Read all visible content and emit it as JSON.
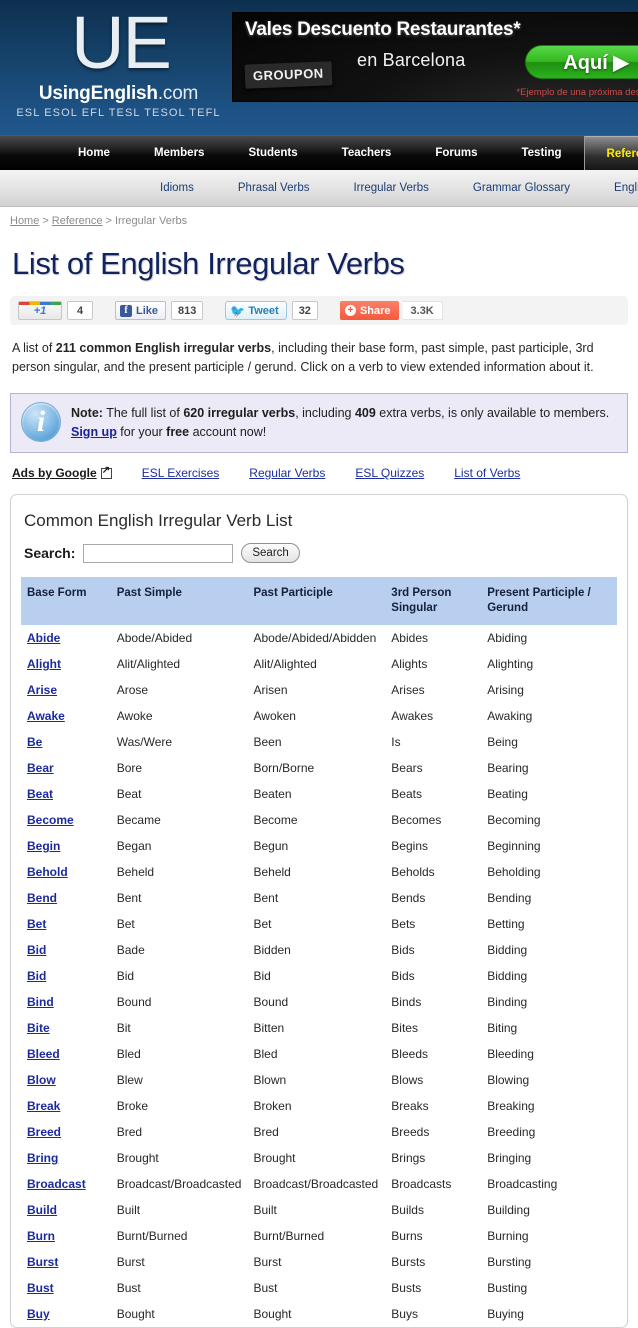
{
  "site": {
    "logo_mark": "UE",
    "logo_name": "UsingEnglish",
    "logo_tld": ".com",
    "logo_tagline": "ESL ESOL EFL TESL TESOL TEFL"
  },
  "ad": {
    "headline": "Vales Descuento Restaurantes*",
    "subline": "en Barcelona",
    "brand": "GROUPON",
    "cta": "Aquí ▶",
    "footnote": "*Ejemplo de una próxima descuento"
  },
  "mainnav": {
    "items": [
      {
        "label": "Home",
        "active": false
      },
      {
        "label": "Members",
        "active": false
      },
      {
        "label": "Students",
        "active": false
      },
      {
        "label": "Teachers",
        "active": false
      },
      {
        "label": "Forums",
        "active": false
      },
      {
        "label": "Testing",
        "active": false
      },
      {
        "label": "Reference",
        "active": true
      }
    ]
  },
  "subnav": {
    "items": [
      {
        "label": "Idioms"
      },
      {
        "label": "Phrasal Verbs"
      },
      {
        "label": "Irregular Verbs"
      },
      {
        "label": "Grammar Glossary"
      },
      {
        "label": "English"
      }
    ]
  },
  "breadcrumb": {
    "home": "Home",
    "section": "Reference",
    "current": "Irregular Verbs",
    "separator": ">"
  },
  "page": {
    "title": "List of English Irregular Verbs",
    "intro_part1": "A list of ",
    "intro_bold": "211 common English irregular verbs",
    "intro_part2": ", including their base form, past simple, past participle, 3rd person singular, and the present participle / gerund. Click on a verb to view extended information about it."
  },
  "social": {
    "gplus_label": "+1",
    "gplus_count": "4",
    "facebook_label": "Like",
    "facebook_icon": "f",
    "facebook_count": "813",
    "twitter_label": "Tweet",
    "twitter_count": "32",
    "share_label": "Share",
    "share_count": "3.3K"
  },
  "note": {
    "prefix": "Note:",
    "text1": " The full list of ",
    "bold1": "620 irregular verbs",
    "text2": ", including ",
    "bold2": "409",
    "text3": " extra verbs, is only available to members. ",
    "link": "Sign up",
    "text4": " for your ",
    "bold3": "free",
    "text5": " account now!"
  },
  "ads_by_google": {
    "label": "Ads by Google",
    "links": [
      "ESL Exercises",
      "Regular Verbs",
      "ESL Quizzes",
      "List of Verbs"
    ]
  },
  "verb_panel": {
    "title": "Common English Irregular Verb List",
    "search_label": "Search:",
    "search_value": "",
    "search_placeholder": "",
    "search_button": "Search",
    "columns": [
      "Base Form",
      "Past Simple",
      "Past Participle",
      "3rd Person Singular",
      "Present Participle / Gerund"
    ],
    "rows": [
      [
        "Abide",
        "Abode/Abided",
        "Abode/Abided/Abidden",
        "Abides",
        "Abiding"
      ],
      [
        "Alight",
        "Alit/Alighted",
        "Alit/Alighted",
        "Alights",
        "Alighting"
      ],
      [
        "Arise",
        "Arose",
        "Arisen",
        "Arises",
        "Arising"
      ],
      [
        "Awake",
        "Awoke",
        "Awoken",
        "Awakes",
        "Awaking"
      ],
      [
        "Be",
        "Was/Were",
        "Been",
        "Is",
        "Being"
      ],
      [
        "Bear",
        "Bore",
        "Born/Borne",
        "Bears",
        "Bearing"
      ],
      [
        "Beat",
        "Beat",
        "Beaten",
        "Beats",
        "Beating"
      ],
      [
        "Become",
        "Became",
        "Become",
        "Becomes",
        "Becoming"
      ],
      [
        "Begin",
        "Began",
        "Begun",
        "Begins",
        "Beginning"
      ],
      [
        "Behold",
        "Beheld",
        "Beheld",
        "Beholds",
        "Beholding"
      ],
      [
        "Bend",
        "Bent",
        "Bent",
        "Bends",
        "Bending"
      ],
      [
        "Bet",
        "Bet",
        "Bet",
        "Bets",
        "Betting"
      ],
      [
        "Bid",
        "Bade",
        "Bidden",
        "Bids",
        "Bidding"
      ],
      [
        "Bid",
        "Bid",
        "Bid",
        "Bids",
        "Bidding"
      ],
      [
        "Bind",
        "Bound",
        "Bound",
        "Binds",
        "Binding"
      ],
      [
        "Bite",
        "Bit",
        "Bitten",
        "Bites",
        "Biting"
      ],
      [
        "Bleed",
        "Bled",
        "Bled",
        "Bleeds",
        "Bleeding"
      ],
      [
        "Blow",
        "Blew",
        "Blown",
        "Blows",
        "Blowing"
      ],
      [
        "Break",
        "Broke",
        "Broken",
        "Breaks",
        "Breaking"
      ],
      [
        "Breed",
        "Bred",
        "Bred",
        "Breeds",
        "Breeding"
      ],
      [
        "Bring",
        "Brought",
        "Brought",
        "Brings",
        "Bringing"
      ],
      [
        "Broadcast",
        "Broadcast/Broadcasted",
        "Broadcast/Broadcasted",
        "Broadcasts",
        "Broadcasting"
      ],
      [
        "Build",
        "Built",
        "Built",
        "Builds",
        "Building"
      ],
      [
        "Burn",
        "Burnt/Burned",
        "Burnt/Burned",
        "Burns",
        "Burning"
      ],
      [
        "Burst",
        "Burst",
        "Burst",
        "Bursts",
        "Bursting"
      ],
      [
        "Bust",
        "Bust",
        "Bust",
        "Busts",
        "Busting"
      ],
      [
        "Buy",
        "Bought",
        "Bought",
        "Buys",
        "Buying"
      ]
    ]
  },
  "colors": {
    "header_blue": "#16436b",
    "nav_black": "#0a0a0a",
    "active_tab_text": "#ffea00",
    "title_navy": "#11235e",
    "link_blue": "#1b2a9c",
    "table_header_blue": "#b9cff0",
    "note_bg": "#eceaf6"
  }
}
